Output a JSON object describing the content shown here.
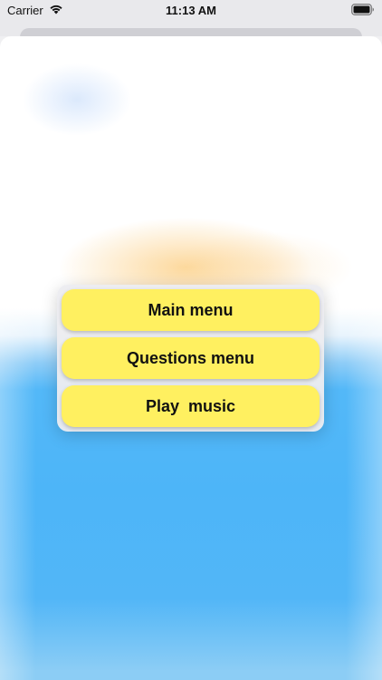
{
  "status_bar": {
    "carrier": "Carrier",
    "time": "11:13 AM",
    "wifi_icon": "wifi-icon",
    "battery_icon": "battery-icon"
  },
  "menu": {
    "items": [
      {
        "label": "Main menu"
      },
      {
        "label": "Questions menu"
      },
      {
        "label": "Play  music"
      }
    ],
    "button_color": "#fff060"
  },
  "colors": {
    "sky_blue": "#4db5f8",
    "menu_panel": "#ececf0"
  }
}
